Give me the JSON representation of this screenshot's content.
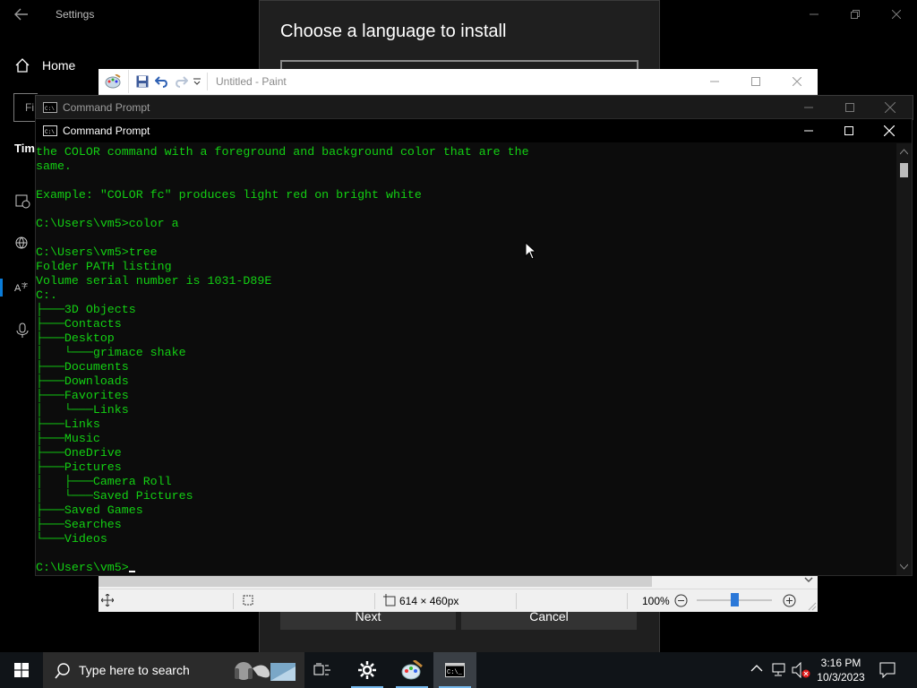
{
  "settings": {
    "title": "Settings",
    "home_label": "Home",
    "find_text": "Fi",
    "time_heading": "Tim"
  },
  "language_dialog": {
    "heading": "Choose a language to install",
    "next_label": "Next",
    "cancel_label": "Cancel"
  },
  "paint": {
    "title": "Untitled - Paint",
    "canvas_size": "614 × 460px",
    "zoom": "100%",
    "zoom_level": 0.5
  },
  "cmd_back": {
    "title": "Command Prompt"
  },
  "cmd_front": {
    "title": "Command Prompt",
    "lines": [
      "the COLOR command with a foreground and background color that are the",
      "same.",
      "",
      "Example: \"COLOR fc\" produces light red on bright white",
      "",
      "C:\\Users\\vm5>color a",
      "",
      "C:\\Users\\vm5>tree",
      "Folder PATH listing",
      "Volume serial number is 1031-D89E",
      "C:.",
      "├───3D Objects",
      "├───Contacts",
      "├───Desktop",
      "│   └───grimace shake",
      "├───Documents",
      "├───Downloads",
      "├───Favorites",
      "│   └───Links",
      "├───Links",
      "├───Music",
      "├───OneDrive",
      "├───Pictures",
      "│   ├───Camera Roll",
      "│   └───Saved Pictures",
      "├───Saved Games",
      "├───Searches",
      "└───Videos",
      "",
      "C:\\Users\\vm5>"
    ]
  },
  "taskbar": {
    "search_placeholder": "Type here to search",
    "time": "3:16 PM",
    "date": "10/3/2023"
  },
  "colors": {
    "terminal_text": "#13d013",
    "terminal_bg": "#0c0c0c",
    "accent": "#0a7cd8"
  }
}
